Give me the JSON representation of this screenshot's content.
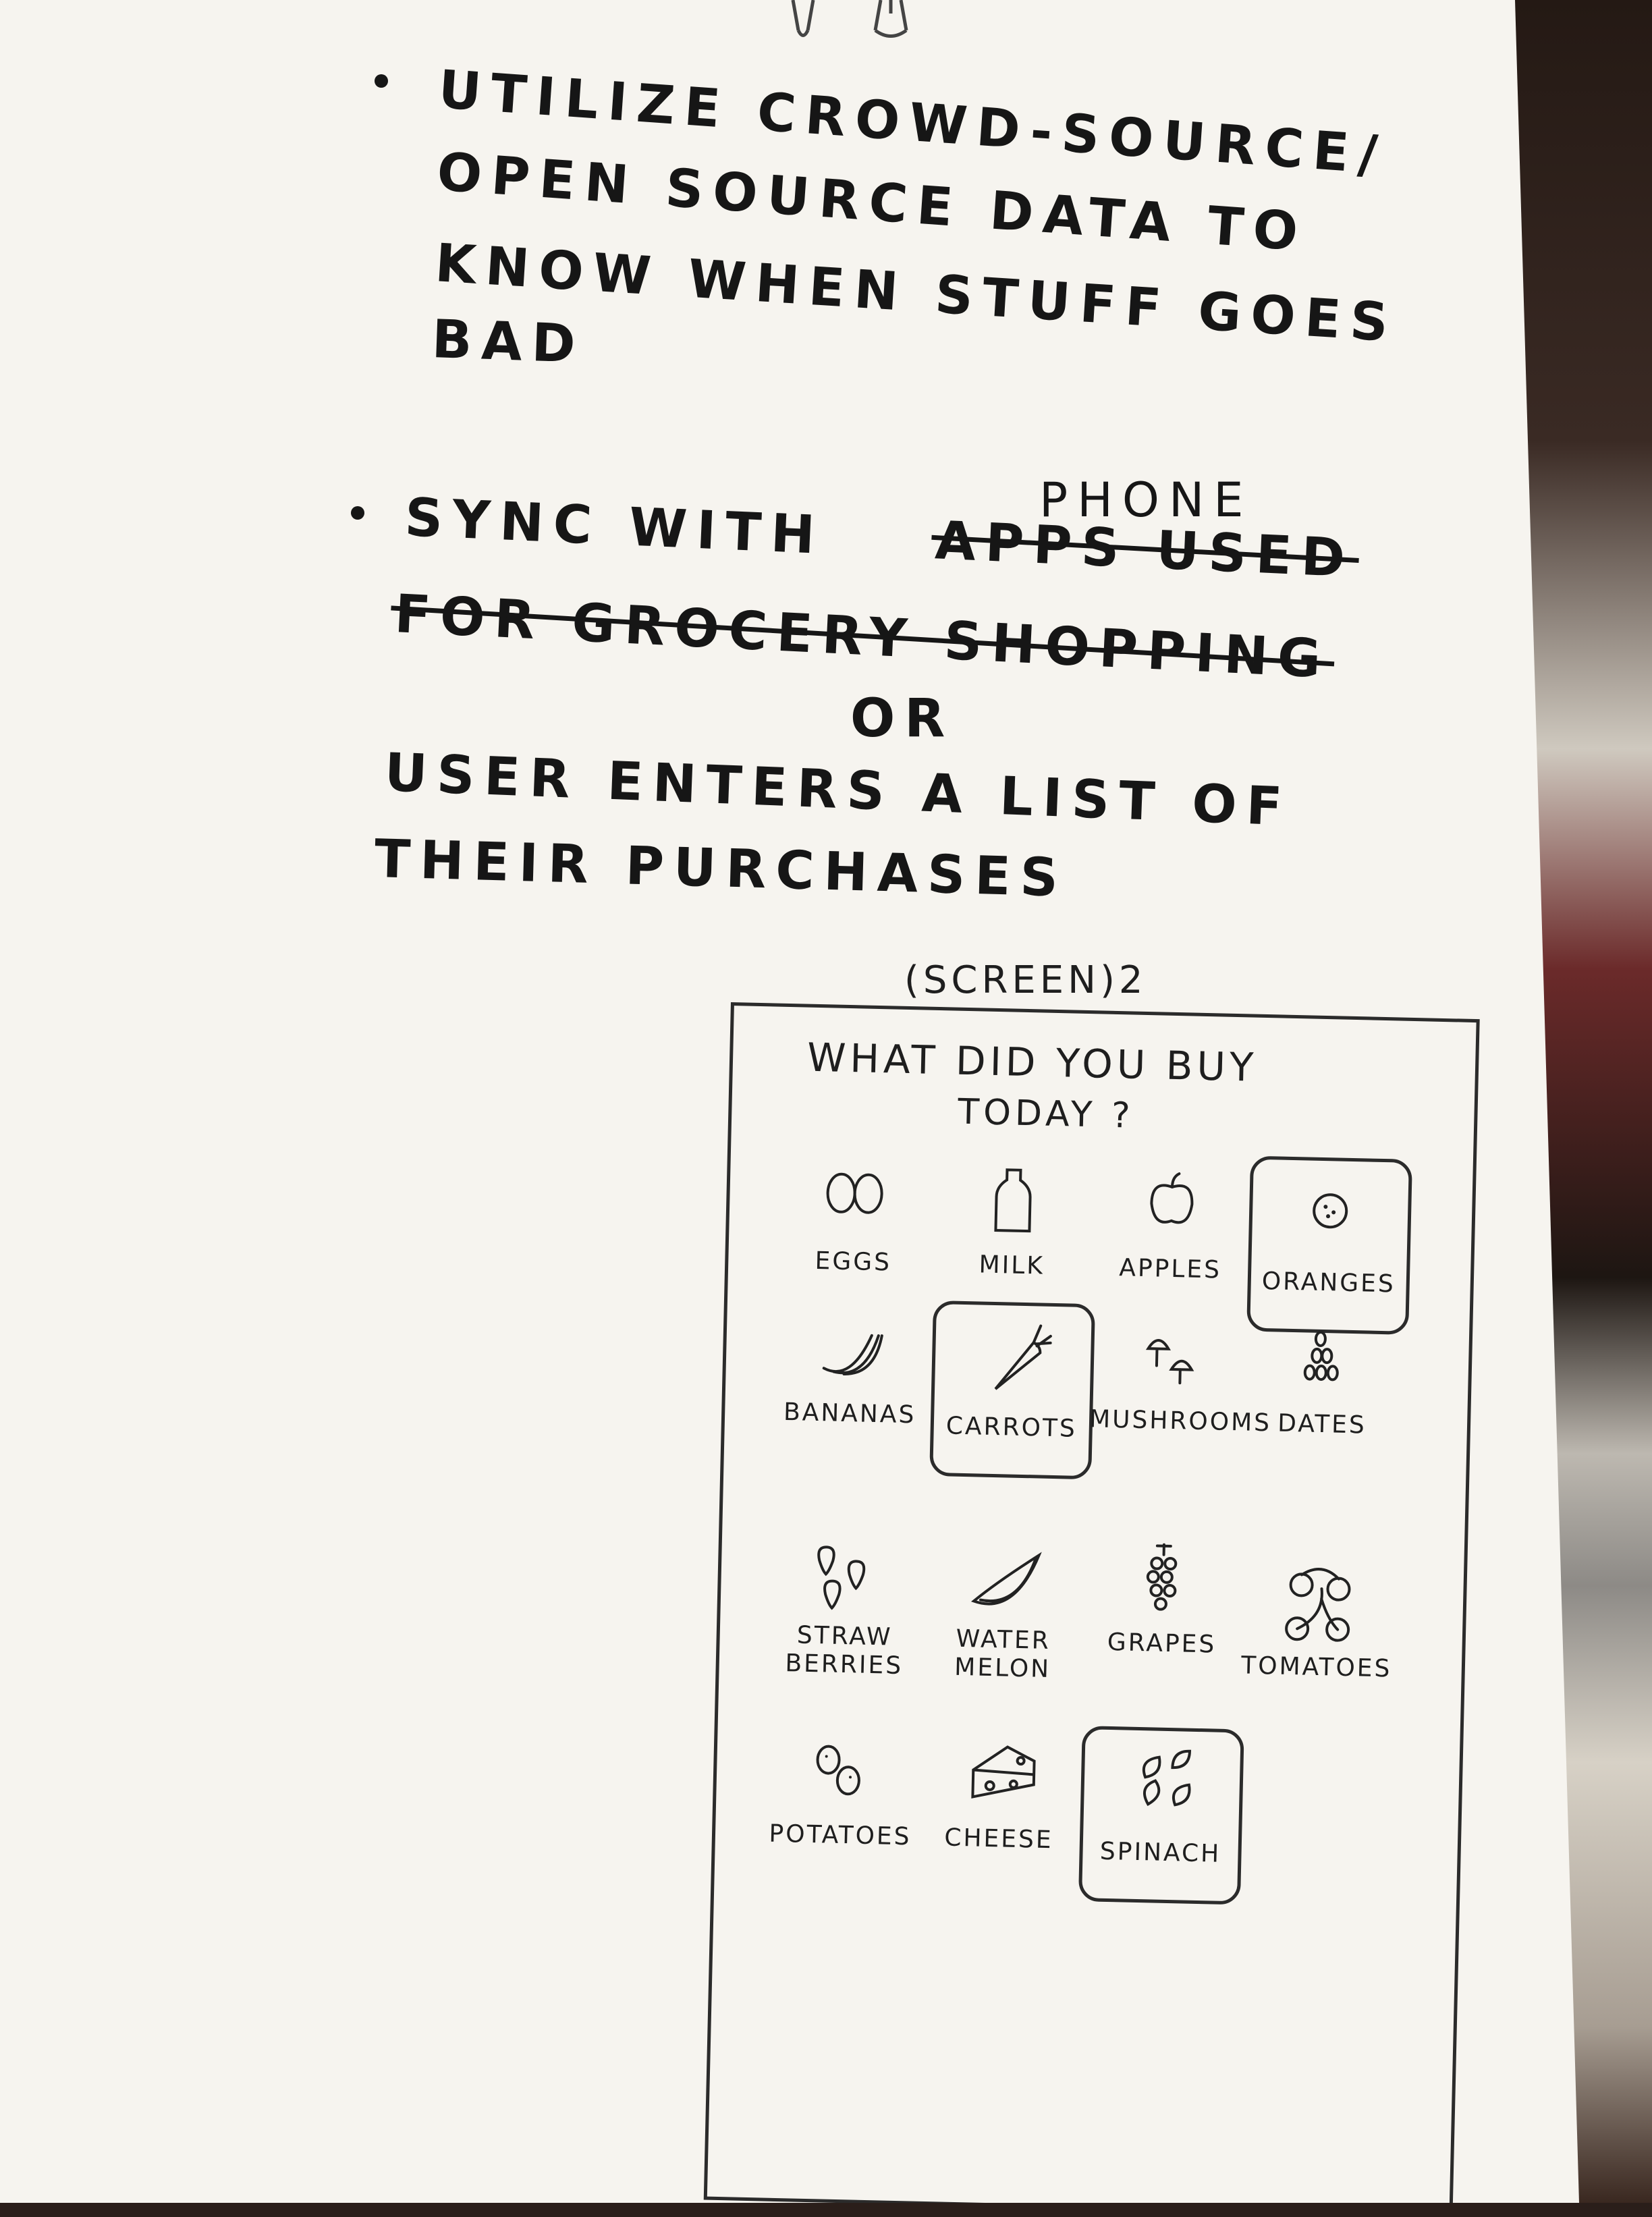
{
  "notes": {
    "bullet1_lines": [
      "UTILIZE  CROWD-SOURCE/",
      "OPEN  SOURCE  DATA  TO",
      "KNOW  WHEN  STUFF  GOES",
      "BAD"
    ],
    "bullet2_insertion": "PHONE",
    "bullet2_line1_start": "SYNC  WITH",
    "bullet2_struck_1": "APPS  USED",
    "bullet2_struck_2": "FOR  GROCERY  SHOPPING",
    "or_text": "OR",
    "alt_lines": [
      "USER  ENTERS  A  LIST  OF",
      "THEIR  PURCHASES"
    ]
  },
  "screen": {
    "label": "(SCREEN)2",
    "prompt_lines": [
      "WHAT  DID  YOU  BUY",
      "TODAY ?"
    ],
    "items": [
      {
        "label": "EGGS",
        "icon": "eggs-icon",
        "selected": false
      },
      {
        "label": "MILK",
        "icon": "milk-icon",
        "selected": false
      },
      {
        "label": "APPLES",
        "icon": "apple-icon",
        "selected": false
      },
      {
        "label": "ORANGES",
        "icon": "orange-icon",
        "selected": true
      },
      {
        "label": "BANANAS",
        "icon": "banana-icon",
        "selected": false
      },
      {
        "label": "CARROTS",
        "icon": "carrot-icon",
        "selected": true
      },
      {
        "label": "MUSHROOMS",
        "icon": "mushroom-icon",
        "selected": false
      },
      {
        "label": "DATES",
        "icon": "dates-icon",
        "selected": false
      },
      {
        "label": "STRAW\nBERRIES",
        "icon": "strawberry-icon",
        "selected": false
      },
      {
        "label": "WATER\nMELON",
        "icon": "watermelon-icon",
        "selected": false
      },
      {
        "label": "GRAPES",
        "icon": "grapes-icon",
        "selected": false
      },
      {
        "label": "TOMATOES",
        "icon": "tomato-icon",
        "selected": false
      },
      {
        "label": "POTATOES",
        "icon": "potato-icon",
        "selected": false
      },
      {
        "label": "CHEESE",
        "icon": "cheese-icon",
        "selected": false
      },
      {
        "label": "SPINACH",
        "icon": "spinach-icon",
        "selected": true
      }
    ]
  }
}
